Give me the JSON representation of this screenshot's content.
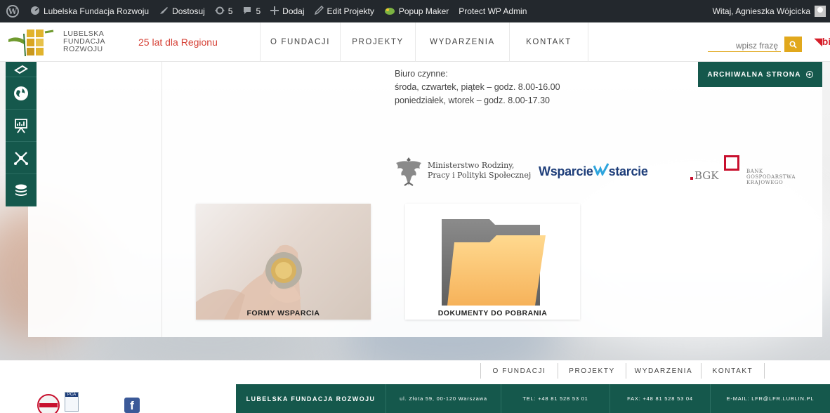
{
  "admin_bar": {
    "site_name": "Lubelska Fundacja Rozwoju",
    "customize": "Dostosuj",
    "updates_count": "5",
    "comments_count": "5",
    "add_new": "Dodaj",
    "edit": "Edit Projekty",
    "popup_maker": "Popup Maker",
    "protect": "Protect WP Admin",
    "greeting": "Witaj, Agnieszka Wójcicka"
  },
  "header": {
    "logo_lines": [
      "LUBELSKA",
      "FUNDACJA",
      "ROZWOJU"
    ],
    "tagline": "25 lat dla Regionu",
    "nav": [
      "O FUNDACJI",
      "PROJEKTY",
      "WYDARZENIA",
      "KONTAKT"
    ],
    "search_placeholder": "wpisz frazę",
    "bip": "bi"
  },
  "main": {
    "office_hours": [
      "Biuro czynne:",
      "środa, czwartek, piątek – godz. 8.00-16.00",
      "poniedziałek, wtorek – godz. 8.00-17.30"
    ],
    "archive_button": "ARCHIWALNA STRONA",
    "sponsors": {
      "ministry": [
        "Ministerstwo Rodziny,",
        "Pracy i Polityki Społecznej"
      ],
      "wsparcie": {
        "part1": "Wsparcie",
        "part2": "starcie"
      },
      "bgk_short": "BGK",
      "bgk_full": [
        "BANK GOSPODARSTWA",
        "KRAJOWEGO"
      ]
    },
    "tiles": [
      "FORMY WSPARCIA",
      "DOKUMENTY DO POBRANIA"
    ]
  },
  "footer": {
    "nav": [
      "O FUNDACJI",
      "PROJEKTY",
      "WYDARZENIA",
      "KONTAKT"
    ],
    "org_name": "LUBELSKA FUNDACJA ROZWOJU",
    "address": "ul. Złota 59, 00-120 Warszawa",
    "tel": "TEL: +48 81 528 53 01",
    "fax": "FAX: +48 81 528 53 04",
    "email": "E-MAIL: LFR@LFR.LUBLIN.PL",
    "cert_label": "PCA"
  },
  "colors": {
    "brand_green": "#15584c",
    "accent_yellow": "#e1a81c",
    "accent_red": "#d64136",
    "admin_bar": "#23282d"
  },
  "sidebar_icons": [
    "coins-icon",
    "globe-icon",
    "presentation-chart-icon",
    "network-icon",
    "coin-stack-icon"
  ]
}
